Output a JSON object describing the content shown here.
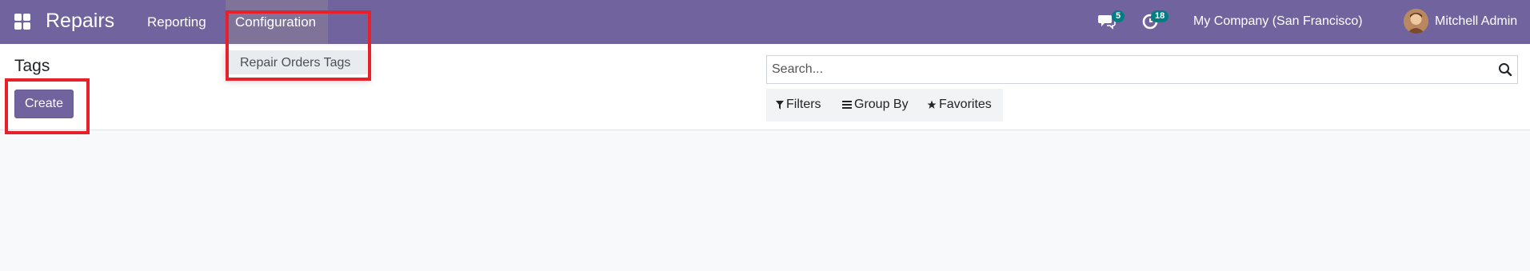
{
  "navbar": {
    "app_name": "Repairs",
    "menu": [
      {
        "label": "Reporting"
      },
      {
        "label": "Configuration"
      }
    ],
    "messages_badge": "5",
    "activities_badge": "18",
    "company": "My Company (San Francisco)",
    "user": "Mitchell Admin"
  },
  "dropdown": {
    "items": [
      {
        "label": "Repair Orders Tags"
      }
    ]
  },
  "control_panel": {
    "title": "Tags",
    "create_label": "Create",
    "search_placeholder": "Search...",
    "filters": [
      {
        "label": "Filters",
        "icon": "filter-icon"
      },
      {
        "label": "Group By",
        "icon": "list-icon"
      },
      {
        "label": "Favorites",
        "icon": "star-icon"
      }
    ]
  },
  "colors": {
    "brand": "#71639e",
    "badge": "#017e84",
    "highlight": "#e8202a"
  }
}
